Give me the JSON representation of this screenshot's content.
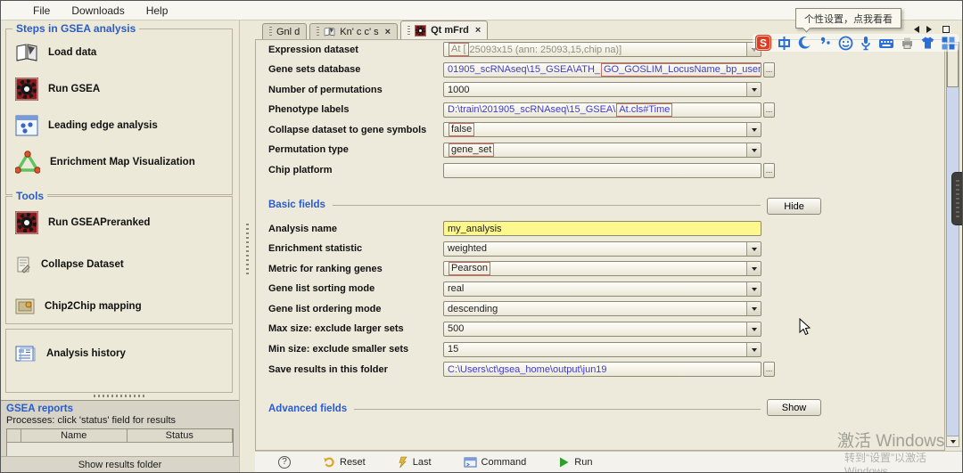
{
  "window": {
    "menu": [
      "File",
      "Downloads",
      "Help"
    ]
  },
  "sidebar": {
    "steps": {
      "title": "Steps in GSEA analysis",
      "items": [
        {
          "label": "Load data",
          "icon": "book-icon"
        },
        {
          "label": "Run GSEA",
          "icon": "gear-icon"
        },
        {
          "label": "Leading edge analysis",
          "icon": "window-icon"
        },
        {
          "label": "Enrichment Map Visualization",
          "icon": "network-icon"
        }
      ]
    },
    "tools": {
      "title": "Tools",
      "items": [
        {
          "label": "Run GSEAPreranked",
          "icon": "gear-icon"
        },
        {
          "label": "Collapse Dataset",
          "icon": "doc-icon"
        },
        {
          "label": "Chip2Chip mapping",
          "icon": "chip-icon"
        }
      ]
    },
    "history_items": [
      {
        "label": "Analysis history",
        "icon": "history-icon"
      }
    ],
    "reports": {
      "title": "GSEA reports",
      "subtitle": "Processes: click 'status' field for results",
      "columns": [
        "Name",
        "Status"
      ],
      "footer_button": "Show results folder"
    }
  },
  "tabs": [
    {
      "label": "Gnl d",
      "icon": "",
      "closable": false,
      "active": false
    },
    {
      "label": "Kn' c c' s",
      "icon": "book-icon",
      "closable": true,
      "active": false
    },
    {
      "label": "Qt mFrd",
      "icon": "gear-icon",
      "closable": true,
      "active": true
    }
  ],
  "form": {
    "top_fields": [
      {
        "label": "Expression dataset",
        "control": "dropdown",
        "color": "gray",
        "segments": [
          {
            "text": "At [",
            "boxed": true
          },
          {
            "text": "25093x15 (ann: 25093,15,chip na)]",
            "boxed": false
          }
        ]
      },
      {
        "label": "Gene sets database",
        "control": "file",
        "color": "blue",
        "segments": [
          {
            "text": "01905_scRNAseq\\15_GSEA\\ATH_",
            "boxed": false
          },
          {
            "text": "GO_GOSLIM_LocusName_bp_useme.gmt",
            "boxed": true
          }
        ]
      },
      {
        "label": "Number of permutations",
        "control": "dropdown",
        "color": "black",
        "segments": [
          {
            "text": "1000",
            "boxed": false
          }
        ]
      },
      {
        "label": "Phenotype labels",
        "control": "file",
        "color": "blue",
        "segments": [
          {
            "text": "D:\\train\\201905_scRNAseq\\15_GSEA\\",
            "boxed": false
          },
          {
            "text": "At.cls#Time",
            "boxed": true
          }
        ]
      },
      {
        "label": "Collapse dataset to gene symbols",
        "control": "dropdown",
        "color": "black",
        "segments": [
          {
            "text": "false",
            "boxed": true
          }
        ]
      },
      {
        "label": "Permutation type",
        "control": "dropdown",
        "color": "black",
        "segments": [
          {
            "text": "gene_set",
            "boxed": true
          }
        ]
      },
      {
        "label": "Chip platform",
        "control": "file",
        "color": "black",
        "segments": []
      }
    ],
    "basic_section": {
      "title": "Basic fields",
      "button": "Hide"
    },
    "basic_fields": [
      {
        "label": "Analysis name",
        "control": "text",
        "color": "black",
        "yellow": true,
        "segments": [
          {
            "text": "my_analysis",
            "boxed": false
          }
        ]
      },
      {
        "label": "Enrichment statistic",
        "control": "dropdown",
        "color": "black",
        "segments": [
          {
            "text": "weighted",
            "boxed": false
          }
        ]
      },
      {
        "label": "Metric for ranking genes",
        "control": "dropdown",
        "color": "black",
        "segments": [
          {
            "text": "Pearson",
            "boxed": true
          }
        ]
      },
      {
        "label": "Gene list sorting mode",
        "control": "dropdown",
        "color": "black",
        "segments": [
          {
            "text": "real",
            "boxed": false
          }
        ]
      },
      {
        "label": "Gene list ordering mode",
        "control": "dropdown",
        "color": "black",
        "segments": [
          {
            "text": "descending",
            "boxed": false
          }
        ]
      },
      {
        "label": "Max size: exclude larger sets",
        "control": "dropdown",
        "color": "black",
        "segments": [
          {
            "text": "500",
            "boxed": false
          }
        ]
      },
      {
        "label": "Min size: exclude smaller sets",
        "control": "dropdown",
        "color": "black",
        "segments": [
          {
            "text": "15",
            "boxed": false
          }
        ]
      },
      {
        "label": "Save results in this folder",
        "control": "file",
        "color": "blue",
        "segments": [
          {
            "text": "C:\\Users\\ct\\gsea_home\\output\\jun19",
            "boxed": false
          }
        ]
      }
    ],
    "advanced_section": {
      "title": "Advanced fields",
      "button": "Show"
    }
  },
  "footer": {
    "help": "?",
    "buttons": [
      {
        "label": "Reset",
        "icon": "reset-icon"
      },
      {
        "label": "Last",
        "icon": "last-icon"
      },
      {
        "label": "Command",
        "icon": "command-icon"
      },
      {
        "label": "Run",
        "icon": "run-icon"
      }
    ]
  },
  "overlay": {
    "tooltip": "个性设置，点我看看",
    "ime_icons": [
      "sogou-icon",
      "zhong-icon",
      "moon-icon",
      "quote-icon",
      "smiley-icon",
      "mic-icon",
      "keyboard-icon",
      "tool-icon",
      "shirt-icon",
      "grid-icon"
    ],
    "watermark": {
      "line1": "激活 Windows",
      "line2": "转到“设置”以激活 Windows"
    }
  }
}
